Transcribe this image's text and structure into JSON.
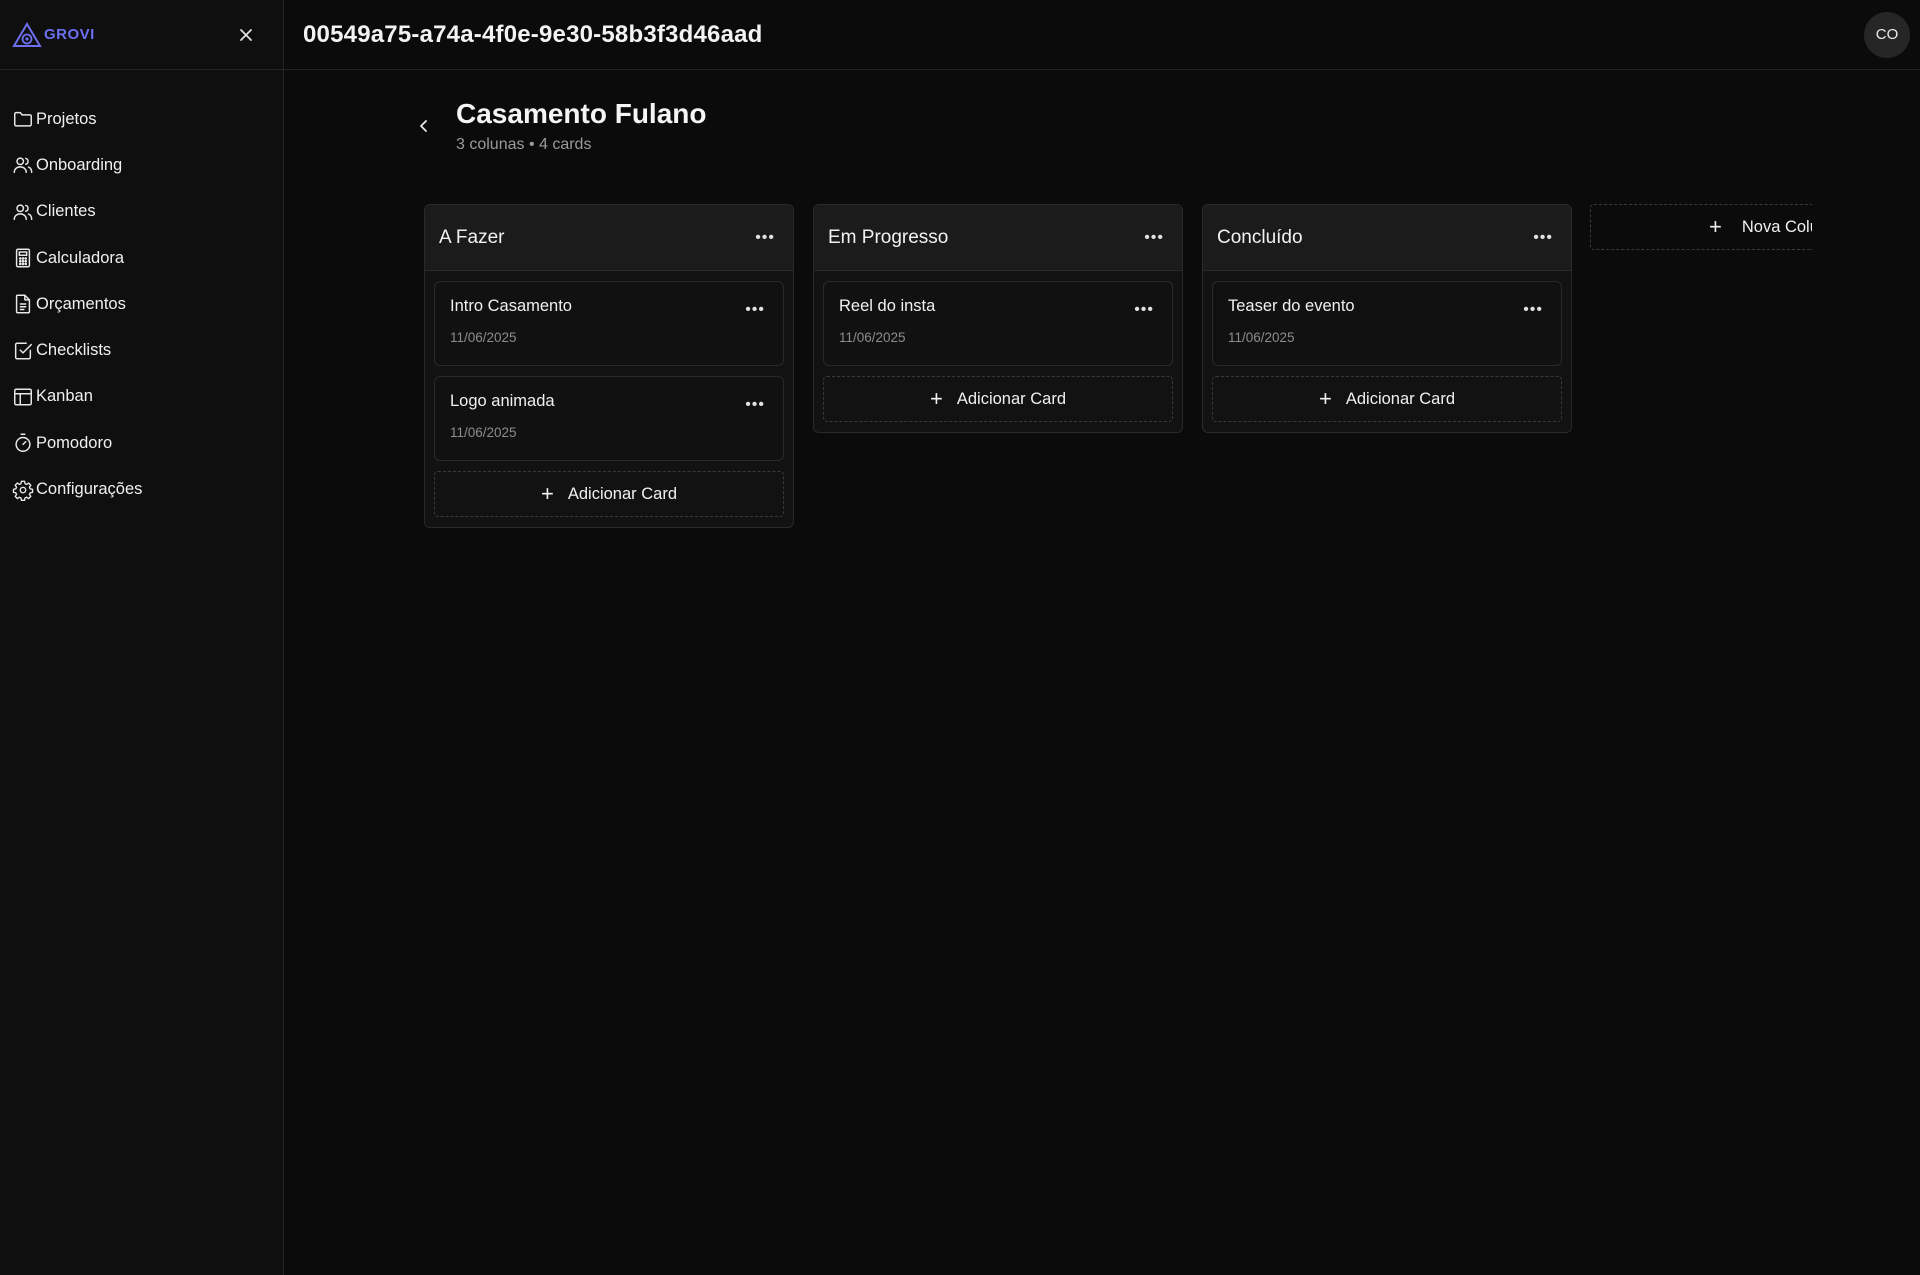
{
  "brand": {
    "name": "GROVI",
    "color": "#6b6ff0"
  },
  "sidebar": {
    "items": [
      {
        "label": "Projetos",
        "icon": "folder-icon"
      },
      {
        "label": "Onboarding",
        "icon": "users-icon"
      },
      {
        "label": "Clientes",
        "icon": "users-icon"
      },
      {
        "label": "Calculadora",
        "icon": "calculator-icon"
      },
      {
        "label": "Orçamentos",
        "icon": "document-icon"
      },
      {
        "label": "Checklists",
        "icon": "checklist-icon"
      },
      {
        "label": "Kanban",
        "icon": "kanban-icon"
      },
      {
        "label": "Pomodoro",
        "icon": "timer-icon"
      },
      {
        "label": "Configurações",
        "icon": "gear-icon"
      }
    ]
  },
  "topbar": {
    "page_id": "00549a75-a74a-4f0e-9e30-58b3f3d46aad",
    "avatar_initials": "CO"
  },
  "board": {
    "title": "Casamento Fulano",
    "meta": "3 colunas • 4 cards",
    "add_card_label": "Adicionar Card",
    "new_column_label": "Nova Coluna",
    "columns": [
      {
        "title": "A Fazer",
        "cards": [
          {
            "title": "Intro Casamento",
            "date": "11/06/2025"
          },
          {
            "title": "Logo animada",
            "date": "11/06/2025"
          }
        ]
      },
      {
        "title": "Em Progresso",
        "cards": [
          {
            "title": "Reel do insta",
            "date": "11/06/2025"
          }
        ]
      },
      {
        "title": "Concluído",
        "cards": [
          {
            "title": "Teaser do evento",
            "date": "11/06/2025"
          }
        ]
      }
    ]
  }
}
